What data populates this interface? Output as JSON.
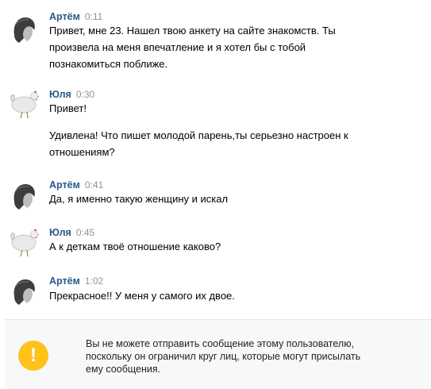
{
  "messages": [
    {
      "author": "Артём",
      "time": "0:11",
      "avatar": "man-portrait-sketch-icon",
      "lines": [
        "Привет, мне 23. Нашел твою анкету на сайте знакомств. Ты",
        "произвела на меня впечатление и я хотел бы с тобой",
        "познакомиться поближе."
      ]
    },
    {
      "author": "Юля",
      "time": "0:30",
      "avatar": "white-chicken-icon",
      "lines": [
        "Привет!",
        "",
        "Удивлена! Что пишет молодой парень,ты серьезно настроен к",
        "отношениям?"
      ]
    },
    {
      "author": "Артём",
      "time": "0:41",
      "avatar": "man-portrait-sketch-icon",
      "lines": [
        "Да, я именно такую женщину и искал"
      ]
    },
    {
      "author": "Юля",
      "time": "0:45",
      "avatar": "white-chicken-icon",
      "lines": [
        "А к деткам твоё отношение каково?"
      ]
    },
    {
      "author": "Артём",
      "time": "1:02",
      "avatar": "man-portrait-sketch-icon",
      "lines": [
        "Прекрасное!! У меня у самого их двое."
      ]
    }
  ],
  "notice": {
    "icon": "warning-exclamation-icon",
    "icon_glyph": "!",
    "lines": [
      "Вы не можете отправить сообщение этому пользователю,",
      "поскольку он ограничил круг лиц, которые могут присылать",
      "ему сообщения."
    ]
  }
}
